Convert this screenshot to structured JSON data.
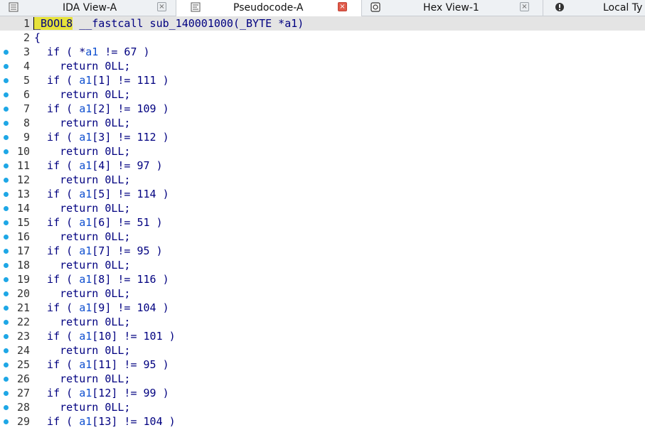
{
  "tabs": [
    {
      "label": "IDA View-A",
      "icon": "ida-view-icon",
      "closable": true,
      "active": false
    },
    {
      "label": "Pseudocode-A",
      "icon": "pseudocode-icon",
      "closable": true,
      "active": true
    },
    {
      "label": "Hex View-1",
      "icon": "hex-view-icon",
      "closable": true,
      "active": false
    },
    {
      "label": "Local Ty",
      "icon": "local-types-icon",
      "closable": false,
      "active": false
    }
  ],
  "colors": {
    "keyword_text": "#000080",
    "variable": "#1050d0",
    "highlight": "#e6e23a",
    "breakpoint_dot": "#1ea7e6",
    "active_close": "#e05a4a"
  },
  "code": {
    "lines": [
      {
        "num": "1",
        "bp": false,
        "tokens": [
          {
            "t": "_BOOL8",
            "c": "hl"
          },
          {
            "t": " __fastcall sub_140001000(_BYTE *a1)",
            "c": ""
          }
        ]
      },
      {
        "num": "2",
        "bp": false,
        "tokens": [
          {
            "t": "{",
            "c": ""
          }
        ]
      },
      {
        "num": "3",
        "bp": true,
        "tokens": [
          {
            "t": "  if ( *",
            "c": ""
          },
          {
            "t": "a1",
            "c": "var"
          },
          {
            "t": " != 67 )",
            "c": ""
          }
        ]
      },
      {
        "num": "4",
        "bp": true,
        "tokens": [
          {
            "t": "    return 0LL;",
            "c": ""
          }
        ]
      },
      {
        "num": "5",
        "bp": true,
        "tokens": [
          {
            "t": "  if ( ",
            "c": ""
          },
          {
            "t": "a1",
            "c": "var"
          },
          {
            "t": "[1] != 111 )",
            "c": ""
          }
        ]
      },
      {
        "num": "6",
        "bp": true,
        "tokens": [
          {
            "t": "    return 0LL;",
            "c": ""
          }
        ]
      },
      {
        "num": "7",
        "bp": true,
        "tokens": [
          {
            "t": "  if ( ",
            "c": ""
          },
          {
            "t": "a1",
            "c": "var"
          },
          {
            "t": "[2] != 109 )",
            "c": ""
          }
        ]
      },
      {
        "num": "8",
        "bp": true,
        "tokens": [
          {
            "t": "    return 0LL;",
            "c": ""
          }
        ]
      },
      {
        "num": "9",
        "bp": true,
        "tokens": [
          {
            "t": "  if ( ",
            "c": ""
          },
          {
            "t": "a1",
            "c": "var"
          },
          {
            "t": "[3] != 112 )",
            "c": ""
          }
        ]
      },
      {
        "num": "10",
        "bp": true,
        "tokens": [
          {
            "t": "    return 0LL;",
            "c": ""
          }
        ]
      },
      {
        "num": "11",
        "bp": true,
        "tokens": [
          {
            "t": "  if ( ",
            "c": ""
          },
          {
            "t": "a1",
            "c": "var"
          },
          {
            "t": "[4] != 97 )",
            "c": ""
          }
        ]
      },
      {
        "num": "12",
        "bp": true,
        "tokens": [
          {
            "t": "    return 0LL;",
            "c": ""
          }
        ]
      },
      {
        "num": "13",
        "bp": true,
        "tokens": [
          {
            "t": "  if ( ",
            "c": ""
          },
          {
            "t": "a1",
            "c": "var"
          },
          {
            "t": "[5] != 114 )",
            "c": ""
          }
        ]
      },
      {
        "num": "14",
        "bp": true,
        "tokens": [
          {
            "t": "    return 0LL;",
            "c": ""
          }
        ]
      },
      {
        "num": "15",
        "bp": true,
        "tokens": [
          {
            "t": "  if ( ",
            "c": ""
          },
          {
            "t": "a1",
            "c": "var"
          },
          {
            "t": "[6] != 51 )",
            "c": ""
          }
        ]
      },
      {
        "num": "16",
        "bp": true,
        "tokens": [
          {
            "t": "    return 0LL;",
            "c": ""
          }
        ]
      },
      {
        "num": "17",
        "bp": true,
        "tokens": [
          {
            "t": "  if ( ",
            "c": ""
          },
          {
            "t": "a1",
            "c": "var"
          },
          {
            "t": "[7] != 95 )",
            "c": ""
          }
        ]
      },
      {
        "num": "18",
        "bp": true,
        "tokens": [
          {
            "t": "    return 0LL;",
            "c": ""
          }
        ]
      },
      {
        "num": "19",
        "bp": true,
        "tokens": [
          {
            "t": "  if ( ",
            "c": ""
          },
          {
            "t": "a1",
            "c": "var"
          },
          {
            "t": "[8] != 116 )",
            "c": ""
          }
        ]
      },
      {
        "num": "20",
        "bp": true,
        "tokens": [
          {
            "t": "    return 0LL;",
            "c": ""
          }
        ]
      },
      {
        "num": "21",
        "bp": true,
        "tokens": [
          {
            "t": "  if ( ",
            "c": ""
          },
          {
            "t": "a1",
            "c": "var"
          },
          {
            "t": "[9] != 104 )",
            "c": ""
          }
        ]
      },
      {
        "num": "22",
        "bp": true,
        "tokens": [
          {
            "t": "    return 0LL;",
            "c": ""
          }
        ]
      },
      {
        "num": "23",
        "bp": true,
        "tokens": [
          {
            "t": "  if ( ",
            "c": ""
          },
          {
            "t": "a1",
            "c": "var"
          },
          {
            "t": "[10] != 101 )",
            "c": ""
          }
        ]
      },
      {
        "num": "24",
        "bp": true,
        "tokens": [
          {
            "t": "    return 0LL;",
            "c": ""
          }
        ]
      },
      {
        "num": "25",
        "bp": true,
        "tokens": [
          {
            "t": "  if ( ",
            "c": ""
          },
          {
            "t": "a1",
            "c": "var"
          },
          {
            "t": "[11] != 95 )",
            "c": ""
          }
        ]
      },
      {
        "num": "26",
        "bp": true,
        "tokens": [
          {
            "t": "    return 0LL;",
            "c": ""
          }
        ]
      },
      {
        "num": "27",
        "bp": true,
        "tokens": [
          {
            "t": "  if ( ",
            "c": ""
          },
          {
            "t": "a1",
            "c": "var"
          },
          {
            "t": "[12] != 99 )",
            "c": ""
          }
        ]
      },
      {
        "num": "28",
        "bp": true,
        "tokens": [
          {
            "t": "    return 0LL;",
            "c": ""
          }
        ]
      },
      {
        "num": "29",
        "bp": true,
        "tokens": [
          {
            "t": "  if ( ",
            "c": ""
          },
          {
            "t": "a1",
            "c": "var"
          },
          {
            "t": "[13] != 104 )",
            "c": ""
          }
        ]
      }
    ]
  }
}
